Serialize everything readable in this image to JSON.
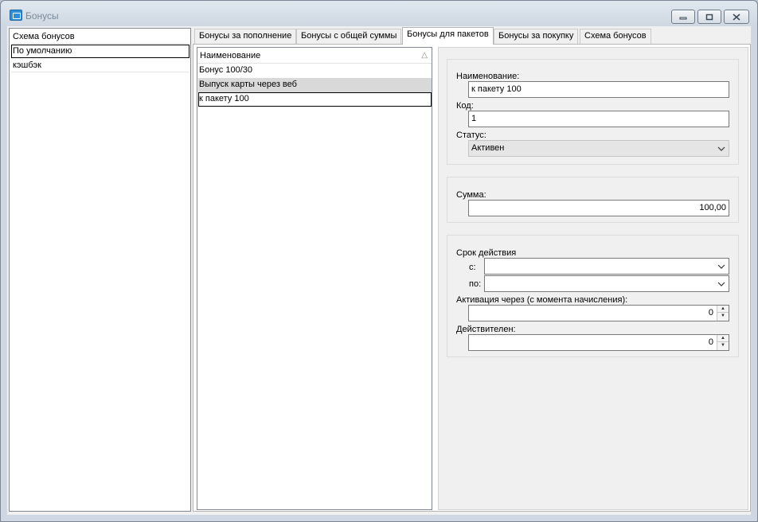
{
  "window": {
    "title": "Бонусы"
  },
  "left_list": {
    "items": [
      {
        "label": "Схема бонусов"
      },
      {
        "label": "По умолчанию"
      },
      {
        "label": "кэшбэк"
      }
    ]
  },
  "tabs": [
    {
      "label": "Бонусы за пополнение"
    },
    {
      "label": "Бонусы с общей суммы"
    },
    {
      "label": "Бонусы для пакетов"
    },
    {
      "label": "Бонусы за покупку"
    },
    {
      "label": "Схема бонусов"
    }
  ],
  "grid": {
    "column_header": "Наименование",
    "rows": [
      {
        "name": "Бонус 100/30"
      },
      {
        "name": "Выпуск карты через веб"
      },
      {
        "name": "к пакету 100"
      }
    ]
  },
  "form": {
    "name_label": "Наименование:",
    "name_value": "к пакету 100",
    "code_label": "Код:",
    "code_value": "1",
    "status_label": "Статус:",
    "status_value": "Активен",
    "sum_label": "Сумма:",
    "sum_value": "100,00",
    "validity_label": "Срок действия",
    "from_label": "с:",
    "from_value": "",
    "to_label": "по:",
    "to_value": "",
    "activation_label": "Активация через (с момента начисления):",
    "activation_value": "0",
    "valid_label": "Действителен:",
    "valid_value": "0"
  }
}
